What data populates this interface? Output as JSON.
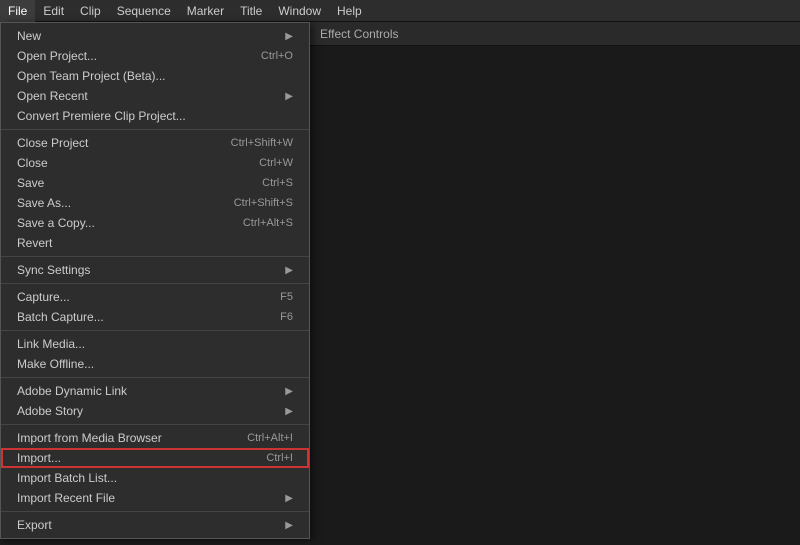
{
  "menubar": {
    "items": [
      {
        "label": "File",
        "active": true
      },
      {
        "label": "Edit"
      },
      {
        "label": "Clip"
      },
      {
        "label": "Sequence"
      },
      {
        "label": "Marker"
      },
      {
        "label": "Title"
      },
      {
        "label": "Window"
      },
      {
        "label": "Help"
      }
    ]
  },
  "file_menu": {
    "sections": [
      {
        "items": [
          {
            "label": "New",
            "shortcut": "",
            "arrow": true,
            "disabled": false
          },
          {
            "label": "Open Project...",
            "shortcut": "Ctrl+O",
            "arrow": false,
            "disabled": false
          },
          {
            "label": "Open Team Project (Beta)...",
            "shortcut": "",
            "arrow": false,
            "disabled": false
          },
          {
            "label": "Open Recent",
            "shortcut": "",
            "arrow": true,
            "disabled": false
          },
          {
            "label": "Convert Premiere Clip Project...",
            "shortcut": "",
            "arrow": false,
            "disabled": false
          }
        ]
      },
      {
        "items": [
          {
            "label": "Close Project",
            "shortcut": "Ctrl+Shift+W",
            "arrow": false,
            "disabled": false
          },
          {
            "label": "Close",
            "shortcut": "Ctrl+W",
            "arrow": false,
            "disabled": false
          },
          {
            "label": "Save",
            "shortcut": "Ctrl+S",
            "arrow": false,
            "disabled": false
          },
          {
            "label": "Save As...",
            "shortcut": "Ctrl+Shift+S",
            "arrow": false,
            "disabled": false
          },
          {
            "label": "Save a Copy...",
            "shortcut": "Ctrl+Alt+S",
            "arrow": false,
            "disabled": false
          },
          {
            "label": "Revert",
            "shortcut": "",
            "arrow": false,
            "disabled": false
          }
        ]
      },
      {
        "items": [
          {
            "label": "Sync Settings",
            "shortcut": "",
            "arrow": true,
            "disabled": false
          }
        ]
      },
      {
        "items": [
          {
            "label": "Capture...",
            "shortcut": "F5",
            "arrow": false,
            "disabled": false
          },
          {
            "label": "Batch Capture...",
            "shortcut": "F6",
            "arrow": false,
            "disabled": false
          }
        ]
      },
      {
        "items": [
          {
            "label": "Link Media...",
            "shortcut": "",
            "arrow": false,
            "disabled": false
          },
          {
            "label": "Make Offline...",
            "shortcut": "",
            "arrow": false,
            "disabled": false
          }
        ]
      },
      {
        "items": [
          {
            "label": "Adobe Dynamic Link",
            "shortcut": "",
            "arrow": true,
            "disabled": false
          },
          {
            "label": "Adobe Story",
            "shortcut": "",
            "arrow": true,
            "disabled": false
          }
        ]
      },
      {
        "items": [
          {
            "label": "Import from Media Browser",
            "shortcut": "Ctrl+Alt+I",
            "arrow": false,
            "disabled": false
          },
          {
            "label": "Import...",
            "shortcut": "Ctrl+I",
            "arrow": false,
            "disabled": false,
            "highlighted": true
          },
          {
            "label": "Import Batch List...",
            "shortcut": "",
            "arrow": false,
            "disabled": false
          },
          {
            "label": "Import Recent File",
            "shortcut": "",
            "arrow": true,
            "disabled": false
          }
        ]
      },
      {
        "items": [
          {
            "label": "Export",
            "shortcut": "",
            "arrow": true,
            "disabled": false
          }
        ]
      }
    ]
  },
  "right_panel": {
    "header": "Effect Controls"
  }
}
